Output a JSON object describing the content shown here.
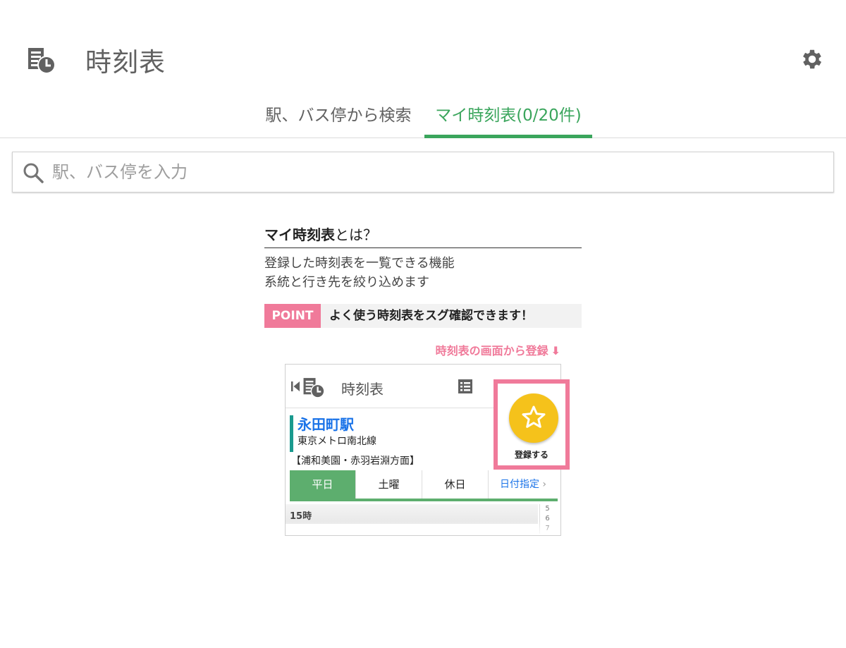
{
  "header": {
    "title": "時刻表",
    "icon": "timetable-icon",
    "settings_icon": "gear-icon"
  },
  "tabs": [
    {
      "label": "駅、バス停から検索",
      "active": false
    },
    {
      "label": "マイ時刻表(0/20件)",
      "active": true
    }
  ],
  "search": {
    "placeholder": "駅、バス停を入力",
    "value": ""
  },
  "info": {
    "title_bold": "マイ時刻表",
    "title_rest": "とは？",
    "desc_line1": "登録した時刻表を一覧できる機能",
    "desc_line2": "系統と行き先を絞り込めます",
    "point_badge": "POINT",
    "point_text": "よく使う時刻表をスグ確認できます！",
    "register_hint": "時刻表の画面から登録",
    "register_arrow": "⬇"
  },
  "preview": {
    "title": "時刻表",
    "station": "永田町駅",
    "line": "東京メトロ南北線",
    "direction": "【浦和美園・赤羽岩淵方面】",
    "day_tabs": [
      "平日",
      "土曜",
      "休日",
      "日付指定"
    ],
    "date_chevron": "›",
    "hour": "15時",
    "minutes": [
      "5",
      "6",
      "7"
    ],
    "register_label": "登録する"
  },
  "colors": {
    "accent_green": "#3aa55c",
    "pink": "#f07a9a",
    "star_yellow": "#f5c21b",
    "link_blue": "#1a73e8"
  }
}
